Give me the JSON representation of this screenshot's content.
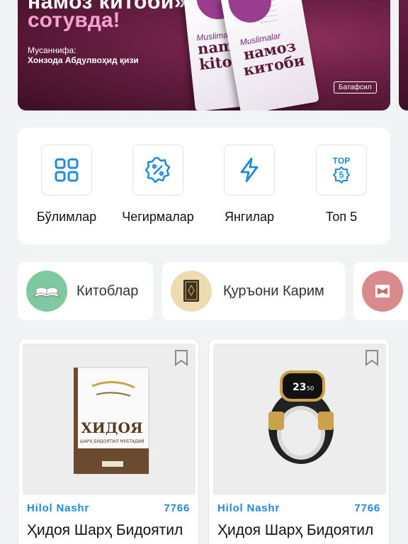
{
  "banner": {
    "title": "намоз китоби»",
    "subtitle": "сотувда!",
    "author_label": "Мусаннифа:",
    "author": "Хонзода Абдулвоҳид қизи",
    "book_small": "Muslimalar",
    "book_title_1": "намоз",
    "book_title_2": "китоби",
    "book_latin_1": "namoz",
    "book_latin_2": "kitobi",
    "more_label": "Батафсил"
  },
  "quick_menu": {
    "items": [
      {
        "label": "Бўлимлар",
        "icon": "grid-icon"
      },
      {
        "label": "Чегирмалар",
        "icon": "discount-icon"
      },
      {
        "label": "Янгилар",
        "icon": "lightning-icon"
      },
      {
        "label": "Топ 5",
        "icon": "top5-icon",
        "badge_text": "TOP",
        "badge_number": "5"
      }
    ]
  },
  "categories": [
    {
      "label": "Китоблар",
      "icon": "open-book-icon"
    },
    {
      "label": "Қуръони Карим",
      "icon": "quran-icon"
    }
  ],
  "products": [
    {
      "publisher": "Hilol Nashr",
      "price": "7766",
      "title": "Ҳидоя Шарҳ Бидоятил",
      "image": "hidoya-book",
      "cover_title": "ХИДОЯ",
      "cover_subtitle": "ШАРҲ БИДОЯТИЛ МУБТАДИЙ"
    },
    {
      "publisher": "Hilol Nashr",
      "price": "7766",
      "title": "Ҳидоя Шарҳ Бидоятил",
      "image": "smart-zikr-ring",
      "ring_time": "23",
      "ring_time_small": "50"
    }
  ],
  "colors": {
    "accent": "#1e8ae0",
    "background": "#f2f3f5",
    "banner": "#6a1f44"
  }
}
